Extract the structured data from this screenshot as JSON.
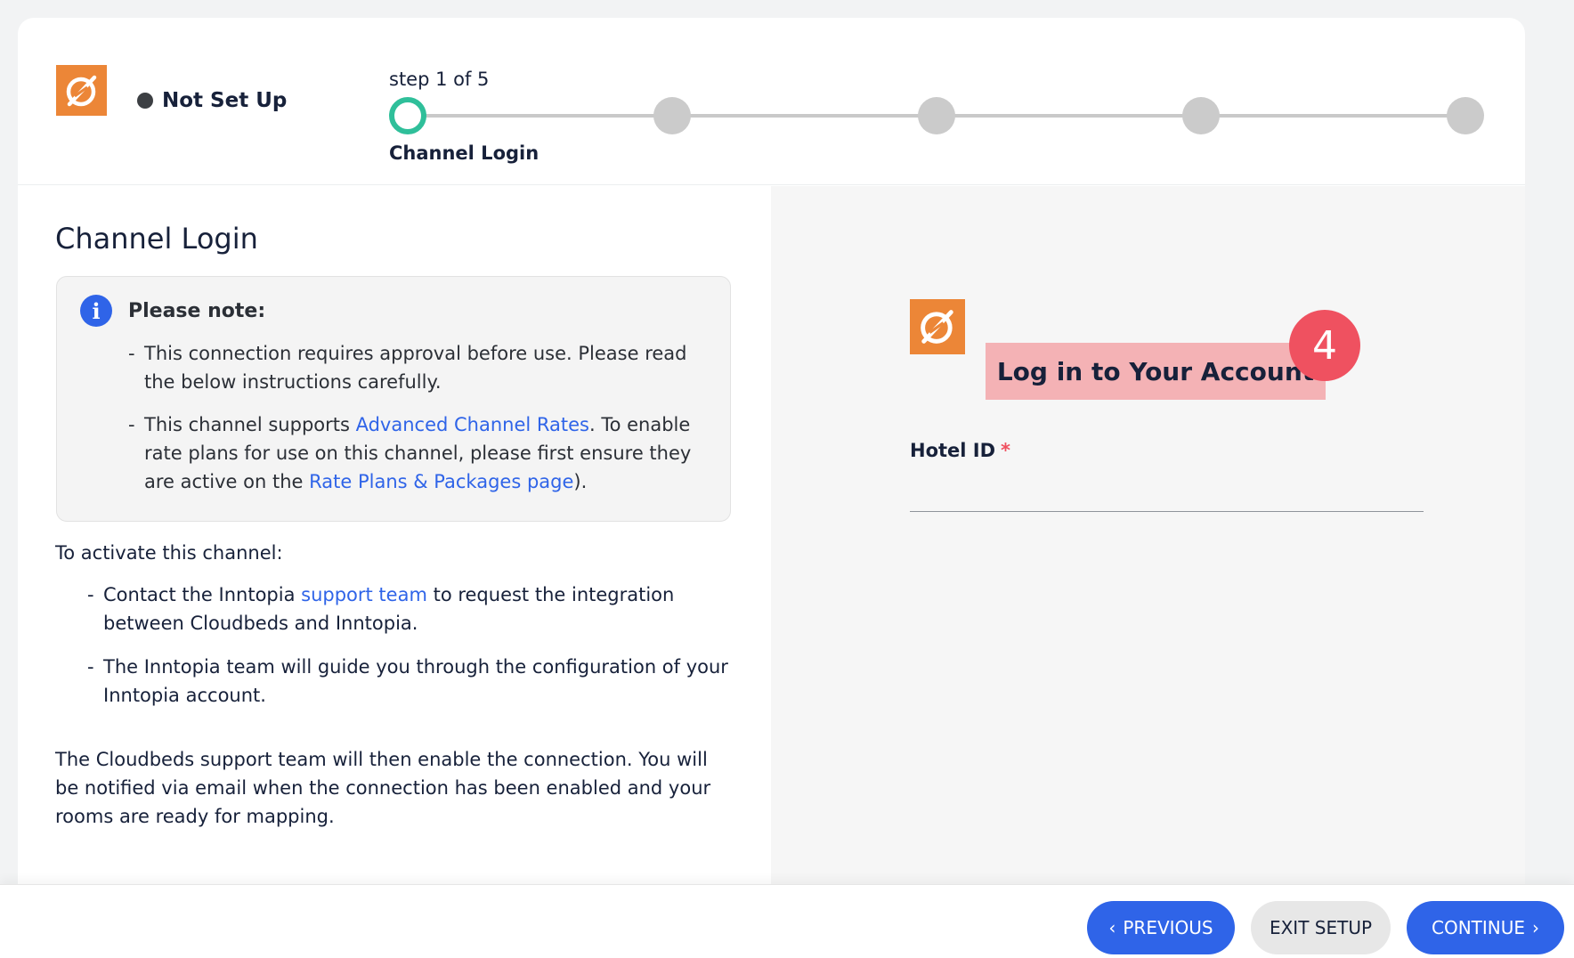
{
  "header": {
    "status_label": "Not Set Up",
    "step_counter": "step 1 of 5",
    "current_step_label": "Channel Login",
    "total_steps": 5,
    "current_step": 1
  },
  "left": {
    "section_title": "Channel Login",
    "note": {
      "title": "Please note:",
      "item1_text": "This connection requires approval before use. Please read the below instructions carefully.",
      "item2_before": "This channel supports ",
      "item2_link": "Advanced Channel Rates",
      "item2_middle": ". To enable rate plans for use on this channel, please first ensure they are active on the ",
      "item2_link2": "Rate Plans & Packages page",
      "item2_after": ")."
    },
    "activate_intro": "To activate this channel:",
    "activate_item1_before": "Contact the Inntopia ",
    "activate_item1_link": "support team",
    "activate_item1_after": " to request the integration between Cloudbeds and Inntopia.",
    "activate_item2": "The Inntopia team will guide you through the configuration of your Inntopia account.",
    "closing": "The Cloudbeds support team will then enable the connection. You will be notified via email when the connection has been enabled and your rooms are ready for mapping."
  },
  "right": {
    "login_heading": "Log in to Your Account",
    "badge_number": "4",
    "hotel_id_label": "Hotel ID",
    "required_mark": "*",
    "hotel_id_value": ""
  },
  "footer": {
    "previous_label": "PREVIOUS",
    "exit_label": "EXIT SETUP",
    "continue_label": "CONTINUE"
  },
  "colors": {
    "brand_orange": "#ec8637",
    "accent_blue": "#2f64e8",
    "active_step_green": "#2fbf9a",
    "badge_red": "#ef5160",
    "highlight_pink": "#f4b2b5"
  }
}
